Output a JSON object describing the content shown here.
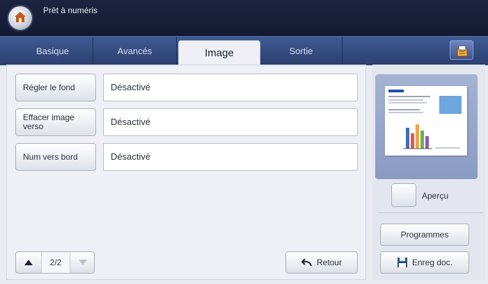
{
  "header": {
    "status": "Prêt à numéris"
  },
  "tabs": [
    {
      "label": "Basique"
    },
    {
      "label": "Avancés"
    },
    {
      "label": "Image",
      "active": true
    },
    {
      "label": "Sortie"
    }
  ],
  "settings": [
    {
      "button": "Régler le fond",
      "value": "Désactivé"
    },
    {
      "button": "Effacer image verso",
      "value": "Désactivé"
    },
    {
      "button": "Num vers bord",
      "value": "Désactivé"
    }
  ],
  "pager": {
    "page": "2/2"
  },
  "actions": {
    "back": "Retour",
    "preview": "Aperçu",
    "programs": "Programmes",
    "save_doc": "Enreg doc."
  },
  "colors": {
    "topbar": "#1b2240",
    "tabbar": "#34497e",
    "panel": "#eef0f5"
  }
}
